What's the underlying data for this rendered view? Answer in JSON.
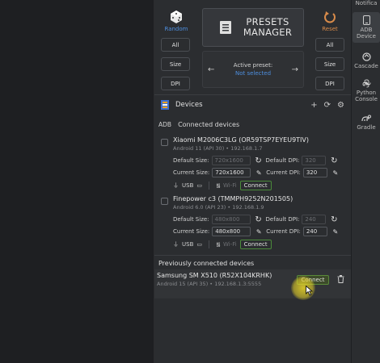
{
  "rail": {
    "items": [
      {
        "label": "Notifica",
        "icon": "bell-icon"
      },
      {
        "label": "ADB Device",
        "icon": "phone-icon",
        "active": true
      },
      {
        "label": "Cascade",
        "icon": "cascade-icon"
      },
      {
        "label": "Python Console",
        "icon": "python-icon"
      },
      {
        "label": "Gradle",
        "icon": "gradle-icon"
      }
    ]
  },
  "top": {
    "random_label": "Random",
    "reset_label": "Reset",
    "left_buttons": [
      "All",
      "Size",
      "DPI"
    ],
    "right_buttons": [
      "All",
      "Size",
      "DPI"
    ],
    "presets_line1": "PRESETS",
    "presets_line2": "MANAGER",
    "active_preset_label": "Active preset:",
    "active_preset_value": "Not selected"
  },
  "devices_panel": {
    "title": "Devices",
    "adb_label": "ADB",
    "connected_heading": "Connected devices",
    "devices": [
      {
        "name": "Xiaomi M2006C3LG (OR59TSP7EYEU9TIV)",
        "sub": "Android 11 (API 30) • 192.168.1.7",
        "default_size_label": "Default Size:",
        "default_size": "720x1600",
        "default_dpi_label": "Default DPI:",
        "default_dpi": "320",
        "current_size_label": "Current Size:",
        "current_size": "720x1600",
        "current_dpi_label": "Current DPI:",
        "current_dpi": "320",
        "usb_label": "USB",
        "wifi_label": "Wi-Fi",
        "connect_label": "Connect"
      },
      {
        "name": "Finepower c3 (TMMPH9252N201505)",
        "sub": "Android 6.0 (API 23) • 192.168.1.9",
        "default_size_label": "Default Size:",
        "default_size": "480x800",
        "default_dpi_label": "Default DPI:",
        "default_dpi": "240",
        "current_size_label": "Current Size:",
        "current_size": "480x800",
        "current_dpi_label": "Current DPI:",
        "current_dpi": "240",
        "usb_label": "USB",
        "wifi_label": "Wi-Fi",
        "connect_label": "Connect"
      }
    ],
    "previous_heading": "Previously connected devices",
    "previous": {
      "name": "Samsung SM X510 (R52X104KRHK)",
      "sub": "Android 15 (API 35) • 192.168.1.3:5555",
      "connect_label": "Connect"
    }
  },
  "colors": {
    "accent_blue": "#4e8fdf",
    "reset_orange": "#d88b4a",
    "connect_green": "#4a8a3a",
    "highlight_yellow": "#ebd728"
  }
}
